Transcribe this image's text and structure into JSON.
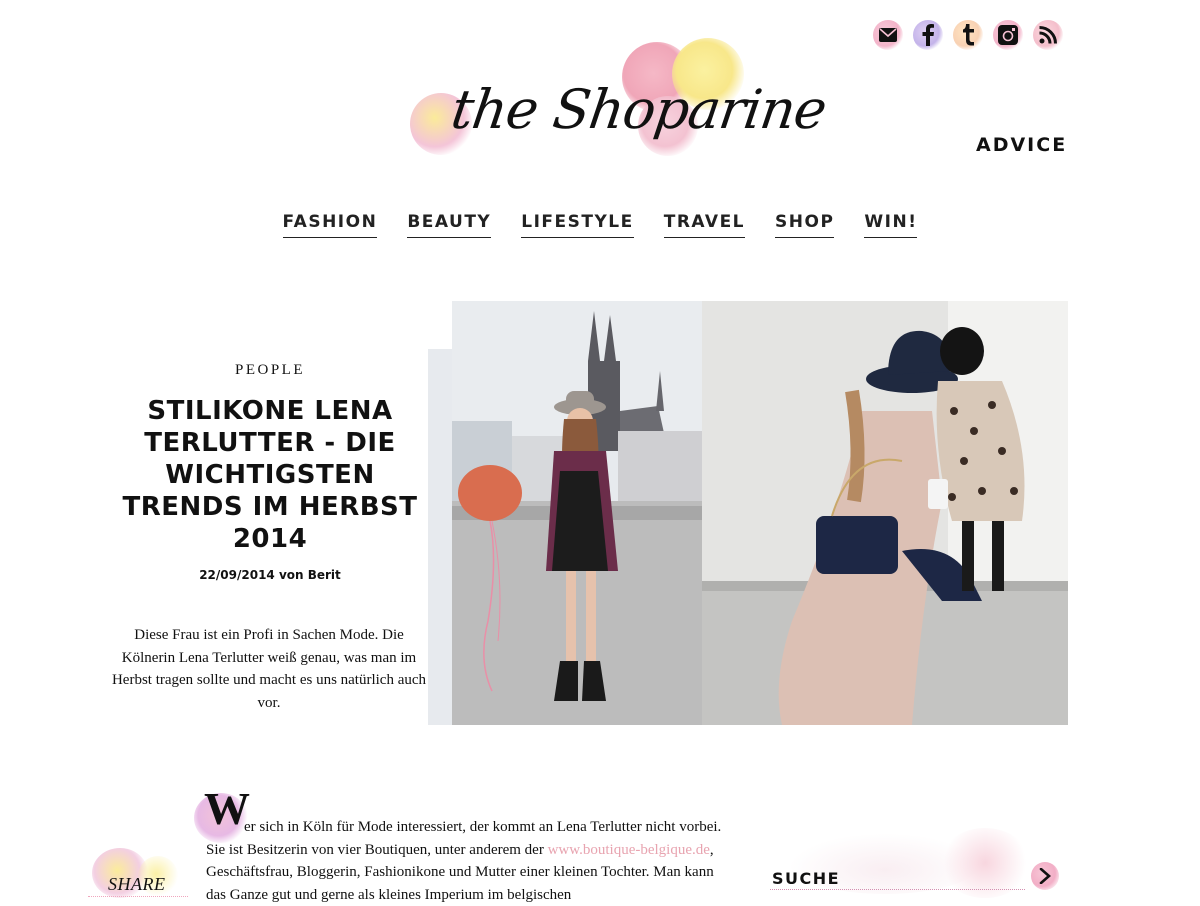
{
  "social": {
    "icons": [
      "mail-icon",
      "facebook-icon",
      "tumblr-icon",
      "instagram-icon",
      "rss-icon"
    ]
  },
  "logo": {
    "text": "the Shoparine"
  },
  "header": {
    "advice_label": "ADVICE"
  },
  "nav": {
    "items": [
      {
        "label": "FASHION"
      },
      {
        "label": "BEAUTY"
      },
      {
        "label": "LIFESTYLE"
      },
      {
        "label": "TRAVEL"
      },
      {
        "label": "SHOP"
      },
      {
        "label": "WIN!"
      }
    ]
  },
  "article": {
    "category": "PEOPLE",
    "title": "STILIKONE LENA TERLUTTER - DIE WICHTIGSTEN TRENDS IM HERBST 2014",
    "byline": "22/09/2014 von Berit",
    "teaser": "Diese Frau ist ein Profi in Sachen Mode. Die Kölnerin Lena Terlutter weiß genau, was man im Herbst tragen sollte und macht es uns natürlich auch vor.",
    "dropcap": "W",
    "body_part1": "er sich in Köln für Mode interessiert, der kommt an Lena Terlutter nicht vorbei. Sie ist Besitzerin von vier Boutiquen, unter anderem der ",
    "body_link": "www.boutique-belgique.de",
    "body_part2": ", Geschäftsfrau, Bloggerin, Fashionikone und Mutter einer kleinen Tochter. Man kann das Ganze gut und gerne als kleines Imperium im belgischen"
  },
  "sidebar": {
    "share_label": "SHARE",
    "search_label": "SUCHE"
  },
  "colors": {
    "accent_pink": "#f1a7c0",
    "link_pink": "#e8a4b0",
    "text": "#111111"
  }
}
